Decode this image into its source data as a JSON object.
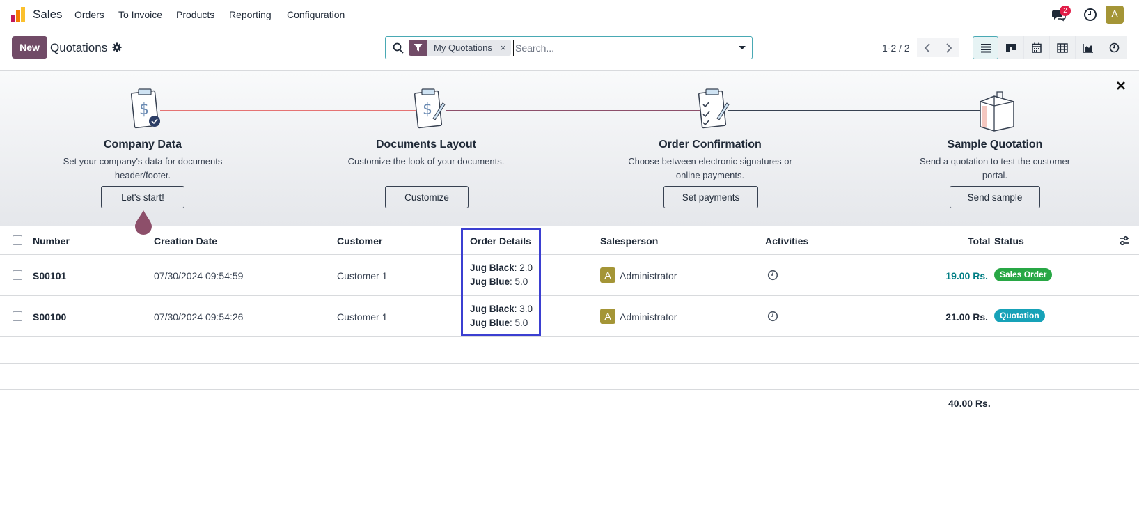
{
  "navbar": {
    "app_name": "Sales",
    "menu": [
      "Orders",
      "To Invoice",
      "Products",
      "Reporting",
      "Configuration"
    ],
    "messages_badge": "2",
    "user_initial": "A"
  },
  "control_panel": {
    "new_label": "New",
    "title": "Quotations",
    "search": {
      "facet_label": "My Quotations",
      "facet_remove": "×",
      "placeholder": "Search..."
    },
    "pager": "1-2 / 2",
    "views": [
      "list-view-icon",
      "kanban-view-icon",
      "calendar-view-icon",
      "pivot-view-icon",
      "graph-view-icon",
      "activity-view-icon"
    ]
  },
  "onboarding": {
    "steps": [
      {
        "title": "Company Data",
        "desc_1": "Set your company's data for documents",
        "desc_2": "header/footer.",
        "button": "Let's start!"
      },
      {
        "title": "Documents Layout",
        "desc_1": "Customize the look of your documents.",
        "desc_2": "",
        "button": "Customize"
      },
      {
        "title": "Order Confirmation",
        "desc_1": "Choose between electronic signatures or",
        "desc_2": "online payments.",
        "button": "Set payments"
      },
      {
        "title": "Sample Quotation",
        "desc_1": "Send a quotation to test the customer",
        "desc_2": "portal.",
        "button": "Send sample"
      }
    ]
  },
  "table": {
    "columns": {
      "number": "Number",
      "creation_date": "Creation Date",
      "customer": "Customer",
      "order_details": "Order Details",
      "salesperson": "Salesperson",
      "activities": "Activities",
      "total": "Total",
      "status": "Status"
    },
    "rows": [
      {
        "number": "S00101",
        "creation_date": "07/30/2024 09:54:59",
        "customer": "Customer 1",
        "details": [
          {
            "product": "Jug Black",
            "qty": ": 2.0"
          },
          {
            "product": "Jug Blue",
            "qty": ": 5.0"
          }
        ],
        "salesperson_initial": "A",
        "salesperson": "Administrator",
        "total": "19.00 Rs.",
        "status": "Sales Order",
        "status_color": "#28a745"
      },
      {
        "number": "S00100",
        "creation_date": "07/30/2024 09:54:26",
        "customer": "Customer 1",
        "details": [
          {
            "product": "Jug Black",
            "qty": ": 3.0"
          },
          {
            "product": "Jug Blue",
            "qty": ": 5.0"
          }
        ],
        "salesperson_initial": "A",
        "salesperson": "Administrator",
        "total": "21.00 Rs.",
        "status": "Quotation",
        "status_color": "#17a2b8"
      }
    ],
    "footer_total": "40.00 Rs."
  },
  "colors": {
    "brand": "#714b67",
    "accent": "#49a9b4",
    "total_link": "#017e84",
    "highlight": "#3b3fd1"
  }
}
